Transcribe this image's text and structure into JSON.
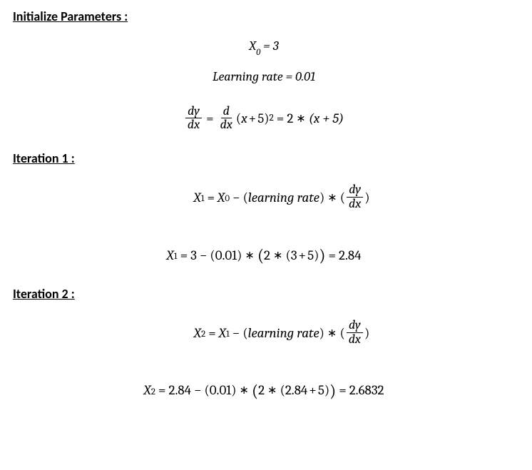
{
  "headings": {
    "init": "Initialize Parameters :",
    "iter1": "Iteration 1 :",
    "iter2": "Iteration 2 :"
  },
  "params": {
    "x0_label": "X",
    "x0_sub": "0",
    "x0_eq": " = ",
    "x0_val": "3",
    "lr_label": "Learning rate = ",
    "lr_val": "0.01"
  },
  "deriv": {
    "dy": "dy",
    "dx": "dx",
    "d": "d",
    "eqL": " = ",
    "lp": "(",
    "x": "x",
    "plus": " + ",
    "five": "5",
    "rp": ")",
    "sq": "2",
    "eqR": " = ",
    "two": "2",
    "star": " ∗ ",
    "ox": "(x + 5)"
  },
  "iter1": {
    "X": "X",
    "s1": "1",
    "s0": "0",
    "eq": " = ",
    "minus": " − ",
    "lr": "learning rate",
    "lp": "(",
    "rp": ")",
    "star": " ∗ ",
    "blp": "(",
    "brp": ")",
    "dy": "dy",
    "dx": "dx",
    "calc_x1": "X",
    "calc_eq": " = ",
    "calc_3": "3",
    "calc_001l": "(",
    "calc_001": "0.01",
    "calc_001r": ")",
    "calc_2": "2",
    "calc_3p5l": "(",
    "calc_3v": "3",
    "calc_plus": " + ",
    "calc_5v": "5",
    "calc_3p5r": ")",
    "calc_res": "2.84"
  },
  "iter2": {
    "X": "X",
    "s2": "2",
    "s1": "1",
    "eq": " = ",
    "minus": " − ",
    "lr": "learning rate",
    "lp": "(",
    "rp": ")",
    "star": " ∗ ",
    "dy": "dy",
    "dx": "dx",
    "calc_2_84": "2.84",
    "calc_001": "0.01",
    "calc_2": "2",
    "calc_plus": " + ",
    "calc_5": "5",
    "calc_res": "2.6832"
  }
}
